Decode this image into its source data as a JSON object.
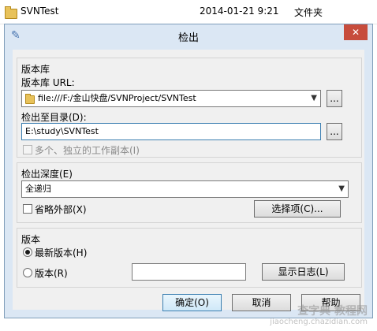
{
  "explorer_row": {
    "name": "SVNTest",
    "date": "2014-01-21 9:21",
    "type": "文件夹"
  },
  "dialog": {
    "title": "检出",
    "close_label": "✕",
    "repository": {
      "group_label": "版本库",
      "url_label": "版本库 URL:",
      "url_value": "file:///F:/金山快盘/SVNProject/SVNTest",
      "browse_label": "...",
      "checkout_dir_label": "检出至目录(D):",
      "checkout_dir_value": "E:\\study\\SVNTest",
      "browse_dir_label": "...",
      "multi_wc_label": "多个、独立的工作副本(I)"
    },
    "depth": {
      "group_label": "检出深度(E)",
      "depth_value": "全递归",
      "omit_externals_label": "省略外部(X)",
      "choose_items_label": "选择项(C)..."
    },
    "revision": {
      "group_label": "版本",
      "head_label": "最新版本(H)",
      "revision_label": "版本(R)",
      "revision_value": "",
      "show_log_label": "显示日志(L)"
    },
    "footer": {
      "ok_label": "确定(O)",
      "cancel_label": "取消",
      "help_label": "帮助"
    }
  },
  "watermark": {
    "line1": "查字典 教程网",
    "line2": "jiaocheng.chazidian.com"
  }
}
